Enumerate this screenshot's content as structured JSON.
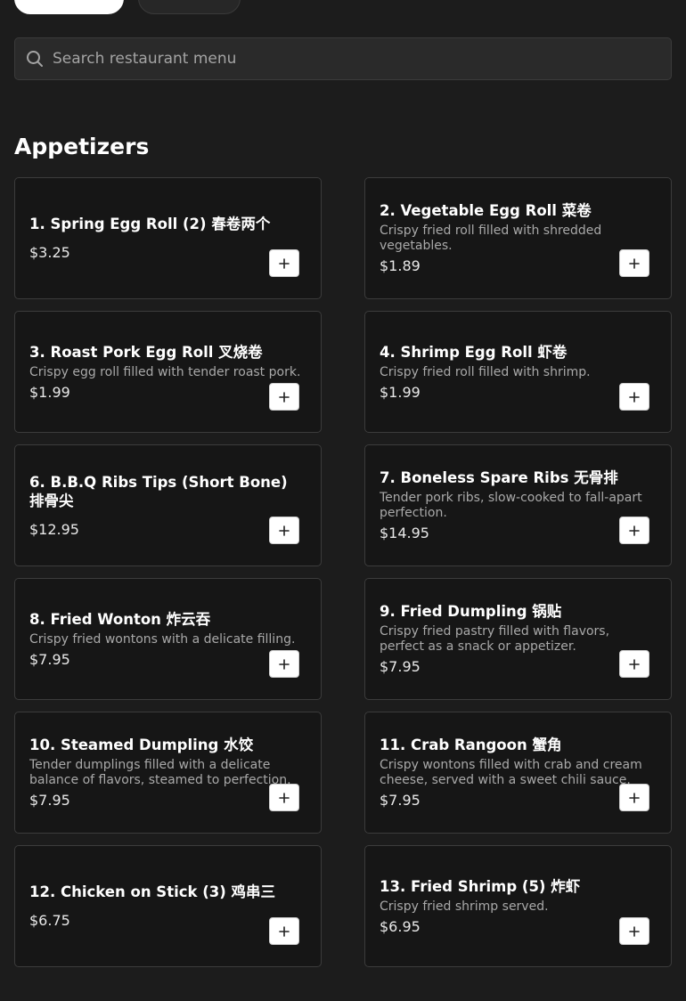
{
  "search": {
    "placeholder": "Search restaurant menu",
    "icon": "search-icon"
  },
  "section": {
    "title": "Appetizers"
  },
  "colors": {
    "background": "#1c1c1c",
    "card": "#161616",
    "border": "#3c3c3c",
    "add_button": "#ffffff"
  },
  "items": [
    {
      "name": "1. Spring Egg Roll (2) 春卷两个",
      "description": "",
      "price": "$3.25"
    },
    {
      "name": "2. Vegetable Egg Roll 菜卷",
      "description": "Crispy fried roll filled with shredded vegetables.",
      "price": "$1.89"
    },
    {
      "name": "3. Roast Pork Egg Roll 叉烧卷",
      "description": "Crispy egg roll filled with tender roast pork.",
      "price": "$1.99"
    },
    {
      "name": "4. Shrimp Egg Roll 虾卷",
      "description": "Crispy fried roll filled with shrimp.",
      "price": "$1.99"
    },
    {
      "name": "6. B.B.Q Ribs Tips (Short Bone) 排骨尖",
      "description": "",
      "price": "$12.95"
    },
    {
      "name": "7. Boneless Spare Ribs 无骨排",
      "description": "Tender pork ribs, slow-cooked to fall-apart perfection.",
      "price": "$14.95"
    },
    {
      "name": "8. Fried Wonton 炸云吞",
      "description": "Crispy fried wontons with a delicate filling.",
      "price": "$7.95"
    },
    {
      "name": "9. Fried Dumpling 锅贴",
      "description": "Crispy fried pastry filled with flavors, perfect as a snack or appetizer.",
      "price": "$7.95"
    },
    {
      "name": "10. Steamed Dumpling 水饺",
      "description": "Tender dumplings filled with a delicate balance of flavors, steamed to perfection.",
      "price": "$7.95"
    },
    {
      "name": "11. Crab Rangoon 蟹角",
      "description": "Crispy wontons filled with crab and cream cheese, served with a sweet chili sauce.",
      "price": "$7.95"
    },
    {
      "name": "12. Chicken on Stick (3) 鸡串三",
      "description": "",
      "price": "$6.75"
    },
    {
      "name": "13. Fried Shrimp (5) 炸虾",
      "description": "Crispy fried shrimp served.",
      "price": "$6.95"
    }
  ],
  "add_button_icon": "plus-icon"
}
